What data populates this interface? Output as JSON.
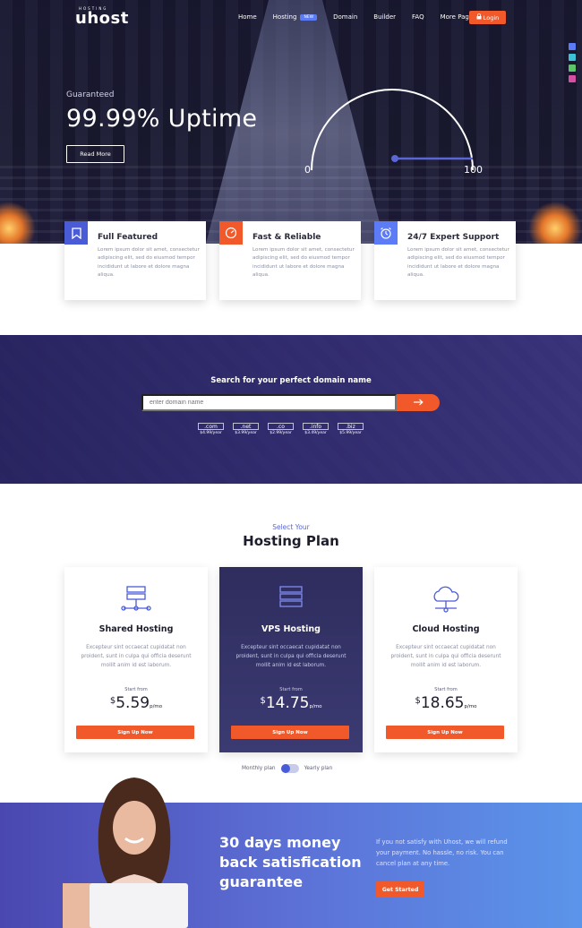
{
  "brand": {
    "name": "uhost",
    "tagline": "HOSTING"
  },
  "nav": {
    "items": [
      {
        "label": "Home"
      },
      {
        "label": "Hosting",
        "badge": "NEW"
      },
      {
        "label": "Domain"
      },
      {
        "label": "Builder"
      },
      {
        "label": "FAQ"
      },
      {
        "label": "More Pages"
      }
    ],
    "login_label": "Login",
    "login_icon": "lock-icon"
  },
  "theme_swatches": [
    "#5b7cf6",
    "#3ec0d6",
    "#5cc56a",
    "#d74fa3"
  ],
  "hero": {
    "subtitle": "Guaranteed",
    "title": "99.99% Uptime",
    "button": "Read More",
    "gauge": {
      "min": "0",
      "max": "100",
      "value_fraction": 0.9999
    }
  },
  "features": [
    {
      "title": "Full Featured",
      "icon": "bookmark-icon",
      "color": "#4a5bd8",
      "text": "Lorem ipsum dolor sit amet, consectetur adipiscing elit, sed do eiusmod tempor incididunt ut labore et dolore magna aliqua."
    },
    {
      "title": "Fast & Reliable",
      "icon": "speedometer-icon",
      "color": "#f2592a",
      "text": "Lorem ipsum dolor sit amet, consectetur adipiscing elit, sed do eiusmod tempor incididunt ut labore et dolore magna aliqua."
    },
    {
      "title": "24/7 Expert Support",
      "icon": "alarm-clock-icon",
      "color": "#5b7cf6",
      "text": "Lorem ipsum dolor sit amet, consectetur adipiscing elit, sed do eiusmod tempor incididunt ut labore et dolore magna aliqua."
    }
  ],
  "domain": {
    "title": "Search for your perfect domain name",
    "placeholder": "enter domain name",
    "tlds": [
      {
        "ext": ".com",
        "price": "$4.99/year"
      },
      {
        "ext": ".net",
        "price": "$3.99/year"
      },
      {
        "ext": ".co",
        "price": "$2.99/year"
      },
      {
        "ext": ".info",
        "price": "$3.49/year"
      },
      {
        "ext": ".biz",
        "price": "$5.99/year"
      }
    ]
  },
  "plans_header": {
    "kicker": "Select Your",
    "title": "Hosting Plan"
  },
  "plans": [
    {
      "name": "Shared Hosting",
      "icon": "server-network-icon",
      "desc": "Excepteur sint occaecat cupidatat non proident, sunt in culpa qui officia deserunt mollit anim id est laborum.",
      "start": "Start from",
      "currency": "$",
      "price": "5.59",
      "per": "p/mo",
      "button": "Sign Up Now"
    },
    {
      "name": "VPS Hosting",
      "icon": "server-stack-icon",
      "desc": "Excepteur sint occaecat cupidatat non proident, sunt in culpa qui officia deserunt mollit anim id est laborum.",
      "start": "Start from",
      "currency": "$",
      "price": "14.75",
      "per": "p/mo",
      "button": "Sign Up Now"
    },
    {
      "name": "Cloud Hosting",
      "icon": "cloud-network-icon",
      "desc": "Excepteur sint occaecat cupidatat non proident, sunt in culpa qui officia deserunt mollit anim id est laborum.",
      "start": "Start from",
      "currency": "$",
      "price": "18.65",
      "per": "p/mo",
      "button": "Sign Up Now"
    }
  ],
  "billing_toggle": {
    "left": "Monthly plan",
    "right": "Yearly plan"
  },
  "guarantee": {
    "title": "30 days money back satisfication guarantee",
    "text": "If you not satisfy with Uhost, we will refund your payment. No hassle, no risk. You can cancel plan at any time.",
    "button": "Get Started"
  }
}
